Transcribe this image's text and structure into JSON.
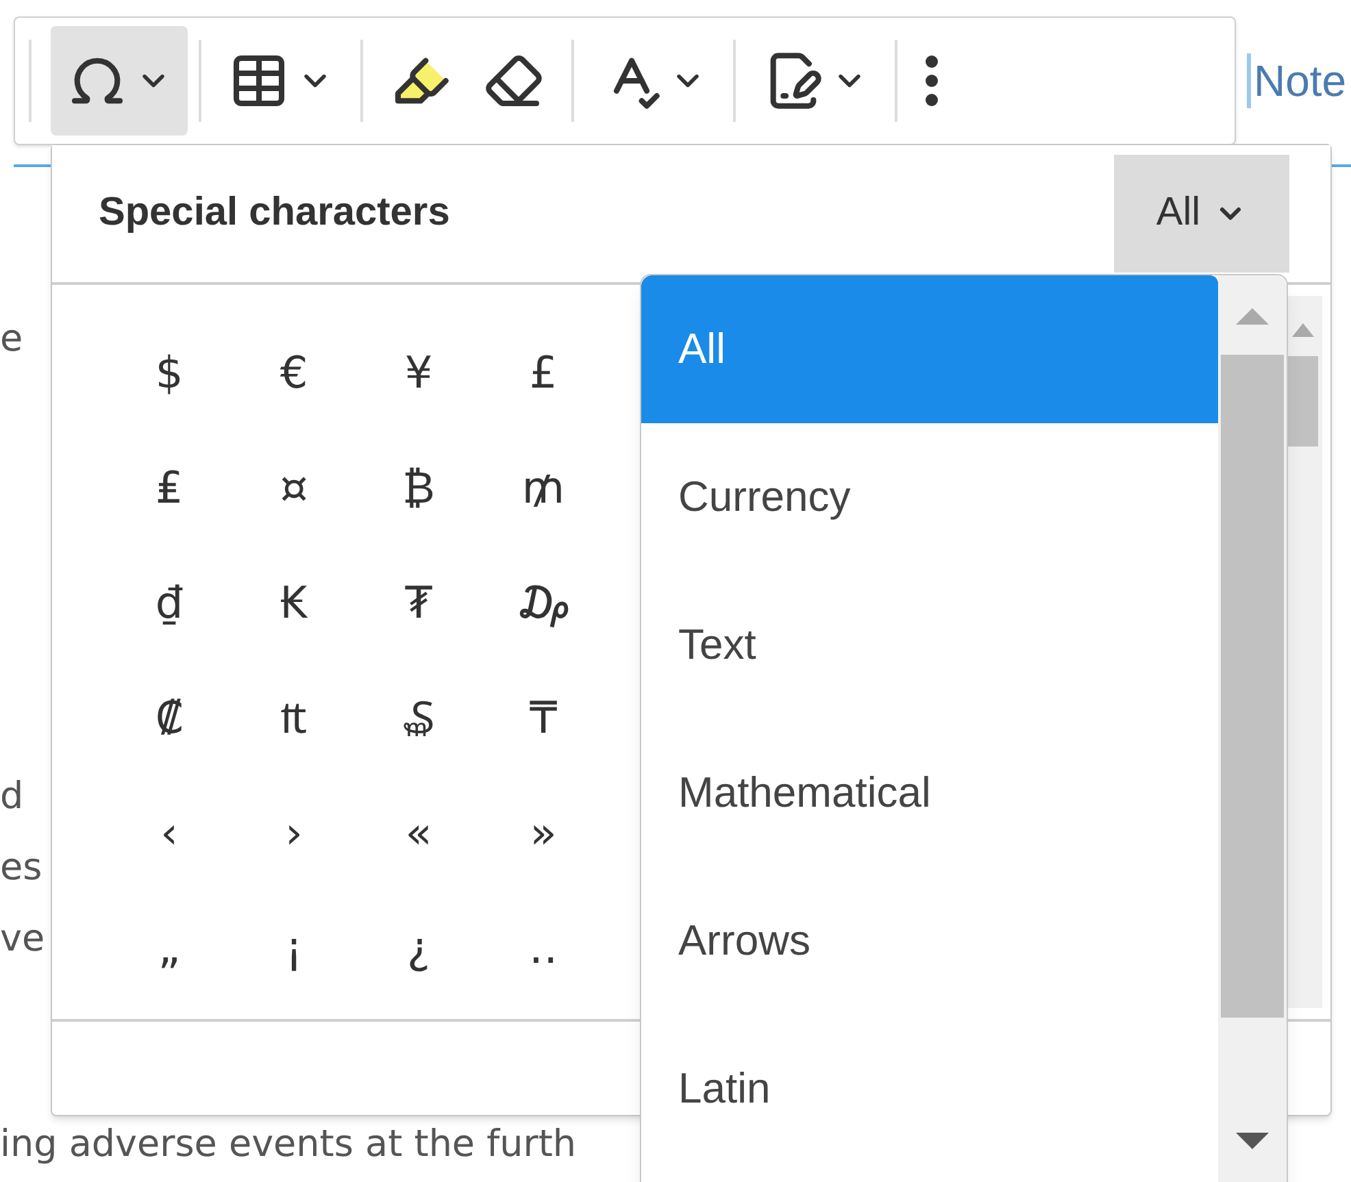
{
  "toolbar": {
    "buttons": [
      {
        "kind": "special-characters",
        "dropdown": true,
        "selected": true
      },
      {
        "kind": "table",
        "dropdown": true,
        "selected": false
      },
      {
        "kind": "highlight",
        "dropdown": false,
        "selected": false
      },
      {
        "kind": "eraser",
        "dropdown": false,
        "selected": false
      },
      {
        "kind": "spellcheck",
        "dropdown": true,
        "selected": false
      },
      {
        "kind": "notes",
        "dropdown": true,
        "selected": false
      },
      {
        "kind": "more",
        "dropdown": false,
        "selected": false
      }
    ]
  },
  "note_link": "Note",
  "document_lines": [
    "e",
    "d",
    "es",
    "ve",
    "ing adverse events at the furth"
  ],
  "panel": {
    "title": "Special characters",
    "category": "All",
    "characters": [
      [
        "$",
        "€",
        "¥",
        "£"
      ],
      [
        "₤",
        "¤",
        "₿",
        "₥"
      ],
      [
        "₫",
        "₭",
        "₮",
        "₯"
      ],
      [
        "₡",
        "₶",
        "₷",
        "₸"
      ],
      [
        "‹",
        "›",
        "«",
        "»"
      ],
      [
        "„",
        "¡",
        "¿",
        "‥"
      ]
    ]
  },
  "category_menu": {
    "options": [
      {
        "label": "All",
        "selected": true
      },
      {
        "label": "Currency",
        "selected": false
      },
      {
        "label": "Text",
        "selected": false
      },
      {
        "label": "Mathematical",
        "selected": false
      },
      {
        "label": "Arrows",
        "selected": false
      },
      {
        "label": "Latin",
        "selected": false
      }
    ]
  }
}
